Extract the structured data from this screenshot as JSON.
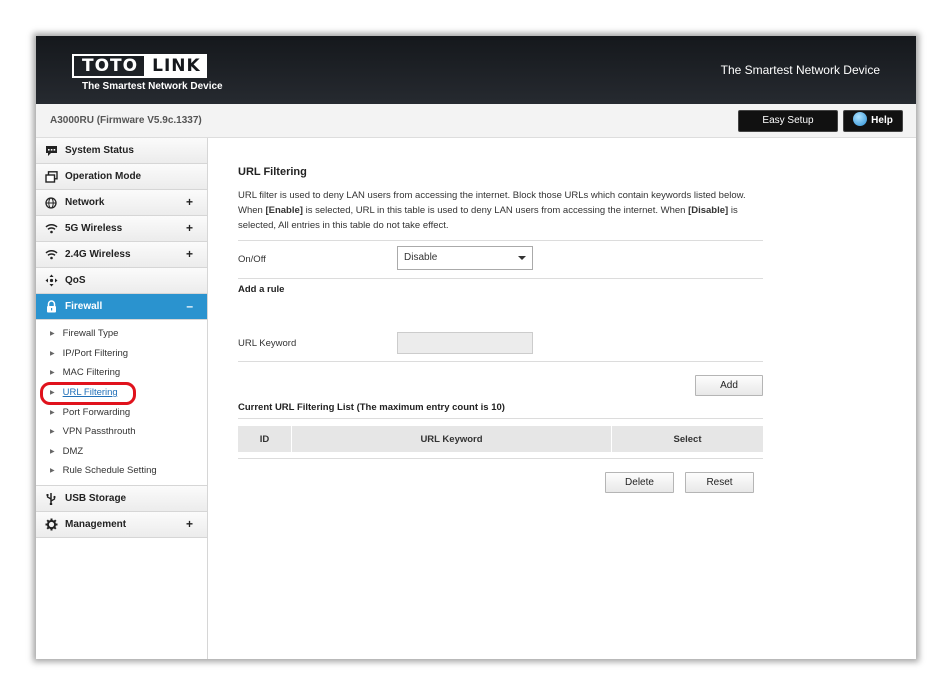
{
  "header": {
    "logo_left": "TOTO",
    "logo_right": "LINK",
    "logo_tagline": "The Smartest Network Device",
    "slogan": "The Smartest Network Device"
  },
  "subbar": {
    "firmware": "A3000RU (Firmware V5.9c.1337)",
    "easy_setup": "Easy Setup",
    "help": "Help"
  },
  "sidebar": {
    "items": [
      {
        "label": "System Status",
        "icon": "chat-bubble-icon",
        "expandable": false
      },
      {
        "label": "Operation Mode",
        "icon": "windows-icon",
        "expandable": false
      },
      {
        "label": "Network",
        "icon": "globe-icon",
        "expandable": true
      },
      {
        "label": "5G Wireless",
        "icon": "wifi-icon",
        "expandable": true
      },
      {
        "label": "2.4G Wireless",
        "icon": "wifi-icon",
        "expandable": true
      },
      {
        "label": "QoS",
        "icon": "qos-icon",
        "expandable": false
      },
      {
        "label": "Firewall",
        "icon": "lock-icon",
        "expandable": true,
        "expanded": true
      }
    ],
    "firewall_subitems": [
      "Firewall Type",
      "IP/Port Filtering",
      "MAC Filtering",
      "URL Filtering",
      "Port Forwarding",
      "VPN Passthrouth",
      "DMZ",
      "Rule Schedule Setting"
    ],
    "bottom_items": [
      {
        "label": "USB Storage",
        "icon": "usb-icon",
        "expandable": false
      },
      {
        "label": "Management",
        "icon": "gear-icon",
        "expandable": true
      }
    ],
    "plus_symbol": "+",
    "minus_symbol": "–",
    "active_color": "#2a93cf"
  },
  "main": {
    "title": "URL Filtering",
    "description_parts": [
      "URL filter is used to deny LAN users from accessing the internet. Block those URLs which contain keywords listed below. When ",
      "[Enable]",
      " is selected, URL in this table is used to deny LAN users from accessing the internet. When ",
      "[Disable]",
      " is selected, All entries in this table do not take effect."
    ],
    "onoff_label": "On/Off",
    "onoff_value": "Disable",
    "add_rule_label": "Add a rule",
    "url_keyword_label": "URL Keyword",
    "url_keyword_value": "",
    "add_button": "Add",
    "list_title": "Current URL Filtering List  (The maximum entry count is 10)",
    "table_headers": [
      "ID",
      "URL Keyword",
      "Select"
    ],
    "delete_button": "Delete",
    "reset_button": "Reset"
  }
}
